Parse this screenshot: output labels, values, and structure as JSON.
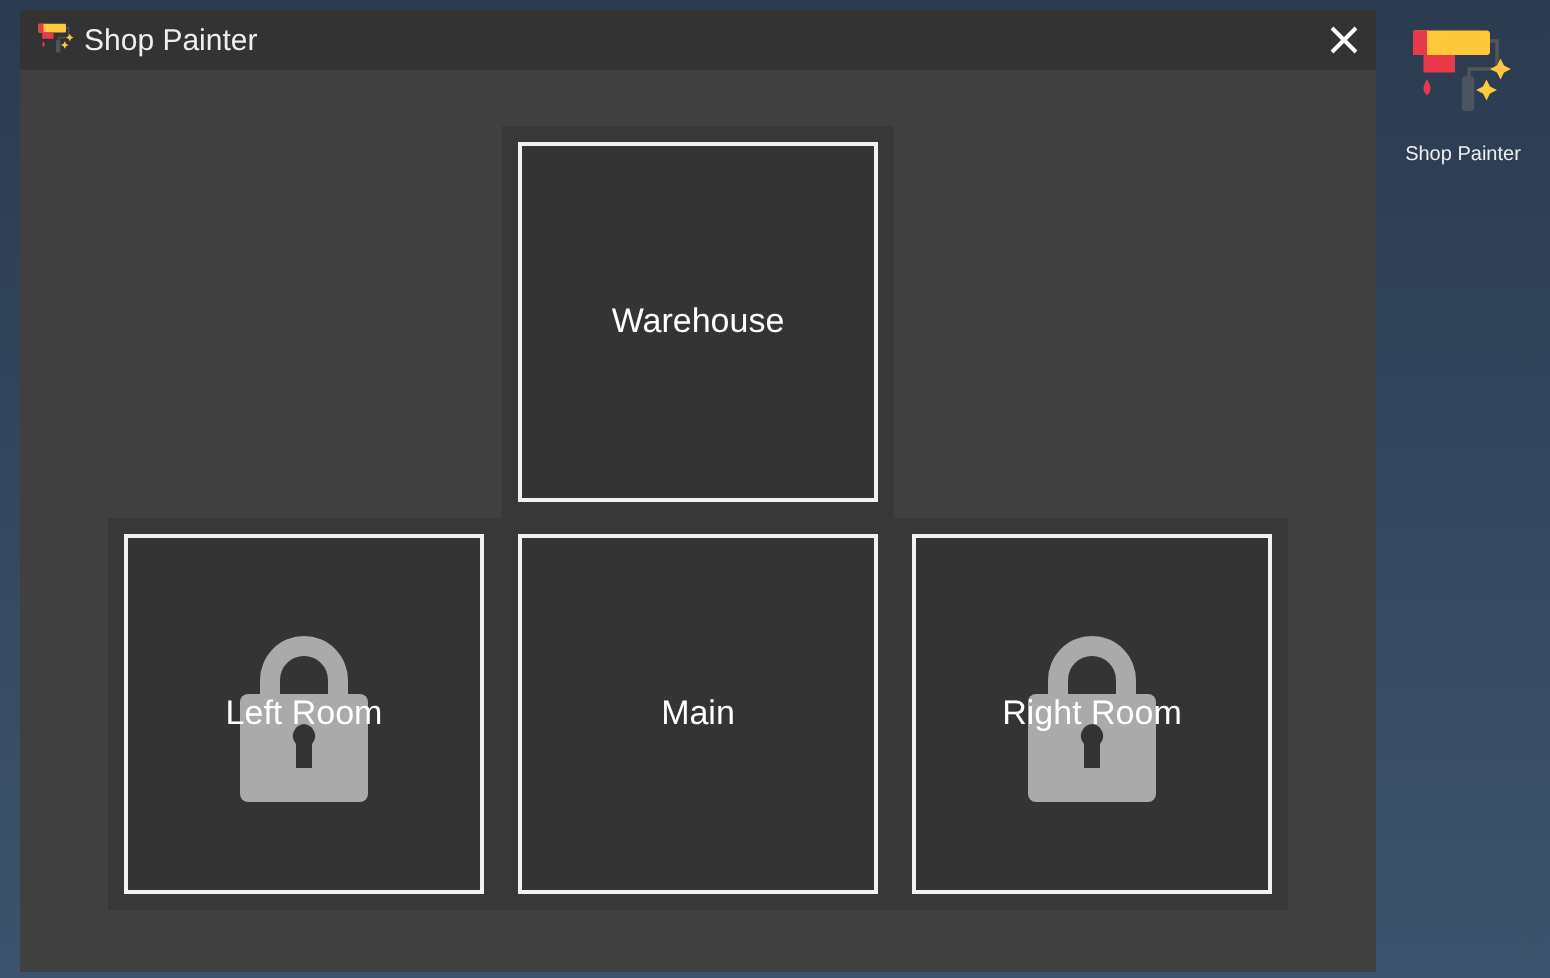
{
  "window": {
    "title": "Shop Painter"
  },
  "rooms": [
    [
      {
        "label": "Warehouse",
        "locked": false
      }
    ],
    [
      {
        "label": "Left Room",
        "locked": true
      },
      {
        "label": "Main",
        "locked": false
      },
      {
        "label": "Right Room",
        "locked": true
      }
    ]
  ],
  "desktop_icon": {
    "label": "Shop Painter"
  }
}
